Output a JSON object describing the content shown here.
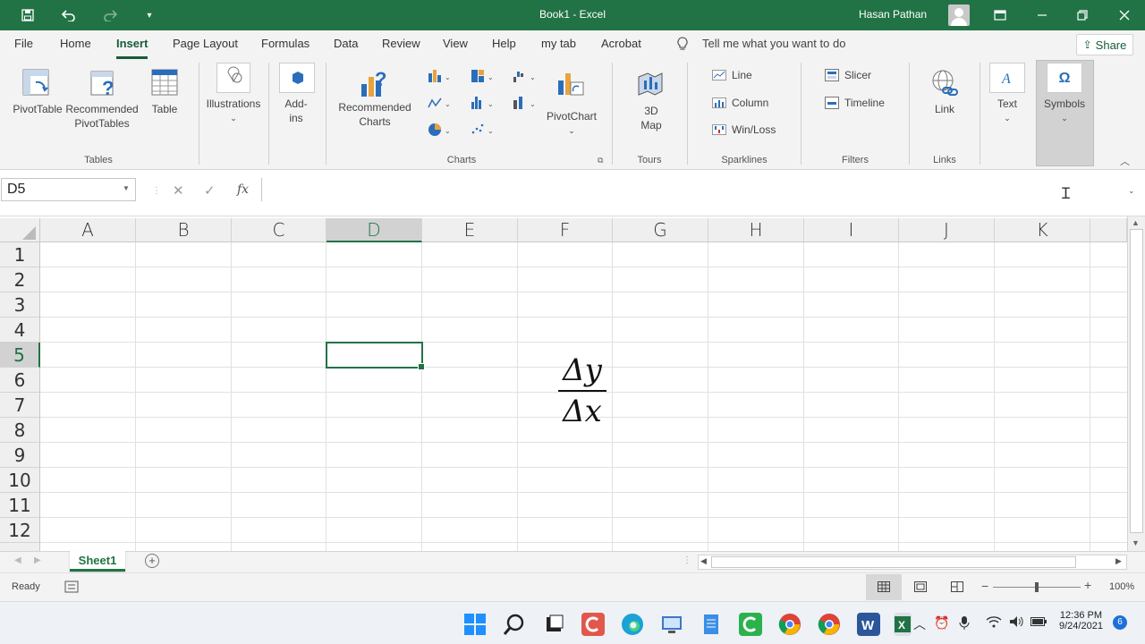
{
  "titlebar": {
    "title": "Book1  -  Excel",
    "user": "Hasan Pathan"
  },
  "tabs": [
    {
      "label": "File"
    },
    {
      "label": "Home"
    },
    {
      "label": "Insert",
      "active": true
    },
    {
      "label": "Page Layout"
    },
    {
      "label": "Formulas"
    },
    {
      "label": "Data"
    },
    {
      "label": "Review"
    },
    {
      "label": "View"
    },
    {
      "label": "Help"
    },
    {
      "label": "my tab"
    },
    {
      "label": "Acrobat"
    }
  ],
  "tell_me": "Tell me what you want to do",
  "share_label": "Share",
  "ribbon": {
    "tables": {
      "pivottable": "PivotTable",
      "recommended_pivottables": "Recommended\nPivotTables",
      "table": "Table",
      "group_label": "Tables"
    },
    "illustrations": "Illustrations",
    "addins": "Add-\nins",
    "charts": {
      "recommended_charts": "Recommended\nCharts",
      "pivotchart": "PivotChart",
      "group_label": "Charts"
    },
    "tours": {
      "map3d": "3D\nMap",
      "group_label": "Tours"
    },
    "sparklines": {
      "line": "Line",
      "column": "Column",
      "winloss": "Win/Loss",
      "group_label": "Sparklines"
    },
    "filters": {
      "slicer": "Slicer",
      "timeline": "Timeline",
      "group_label": "Filters"
    },
    "links": {
      "link": "Link",
      "group_label": "Links"
    },
    "text": "Text",
    "symbols": "Symbols"
  },
  "formula_bar": {
    "name_box": "D5",
    "fx": "fx",
    "formula": ""
  },
  "columns": [
    "A",
    "B",
    "C",
    "D",
    "E",
    "F",
    "G",
    "H",
    "I",
    "J",
    "K"
  ],
  "rows": [
    "1",
    "2",
    "3",
    "4",
    "5",
    "6",
    "7",
    "8",
    "9",
    "10",
    "11",
    "12"
  ],
  "active_cell": "D5",
  "equation": {
    "numerator": "Δy",
    "denominator": "Δx"
  },
  "sheet_tab": "Sheet1",
  "status": {
    "ready": "Ready",
    "zoom": "100%",
    "zoom_slider_percent": 100
  },
  "taskbar": {
    "time": "12:36 PM",
    "date": "9/24/2021",
    "notifications": "6"
  },
  "colors": {
    "excel_green": "#217346",
    "dark_green": "#185c37"
  }
}
